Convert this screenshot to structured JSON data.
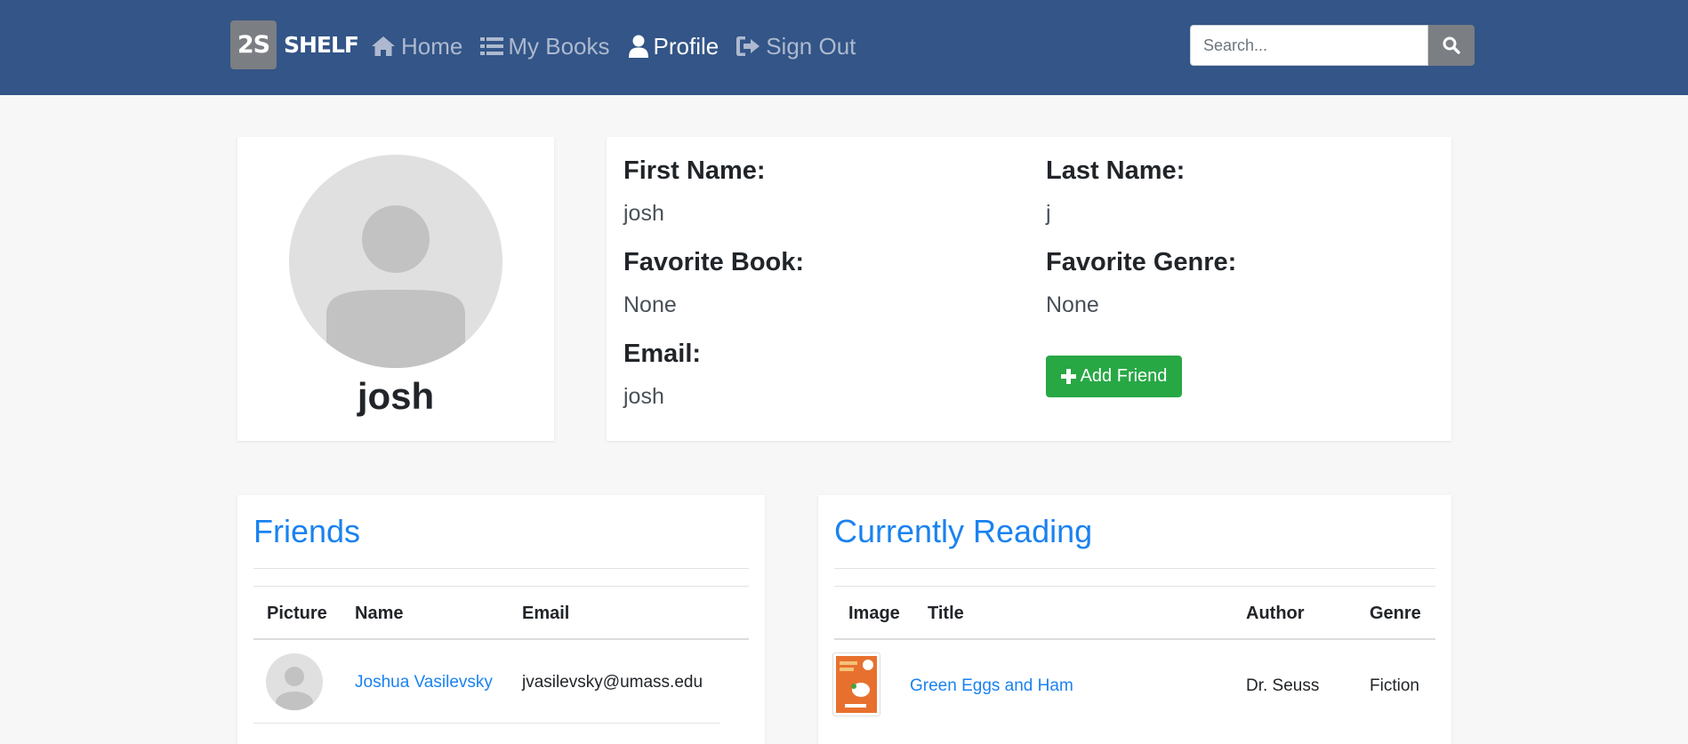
{
  "brand": {
    "logo_text": "2S",
    "name": "SHELF"
  },
  "nav": [
    {
      "label": "Home",
      "icon": "home-icon"
    },
    {
      "label": "My Books",
      "icon": "list-icon"
    },
    {
      "label": "Profile",
      "icon": "user-icon",
      "active": true
    },
    {
      "label": "Sign Out",
      "icon": "sign-out-icon"
    }
  ],
  "search": {
    "placeholder": "Search...",
    "icon": "search-icon"
  },
  "profile": {
    "username": "josh",
    "fields": {
      "first_name_label": "First Name:",
      "first_name": "josh",
      "last_name_label": "Last Name:",
      "last_name": "j",
      "favorite_book_label": "Favorite Book:",
      "favorite_book": "None",
      "favorite_genre_label": "Favorite Genre:",
      "favorite_genre": "None",
      "email_label": "Email:",
      "email": "josh"
    },
    "add_friend_label": "Add Friend"
  },
  "friends": {
    "title": "Friends",
    "columns": [
      "Picture",
      "Name",
      "Email"
    ],
    "rows": [
      {
        "name": "Joshua Vasilevsky",
        "email": "jvasilevsky@umass.edu"
      }
    ]
  },
  "reading": {
    "title": "Currently Reading",
    "columns": [
      "Image",
      "Title",
      "Author",
      "Genre"
    ],
    "rows": [
      {
        "title": "Green Eggs and Ham",
        "author": "Dr. Seuss",
        "genre": "Fiction"
      }
    ]
  },
  "colors": {
    "navbar": "#335587",
    "link": "#1a82f0",
    "success": "#28a745",
    "nav_inactive": "#aeb9cf"
  }
}
